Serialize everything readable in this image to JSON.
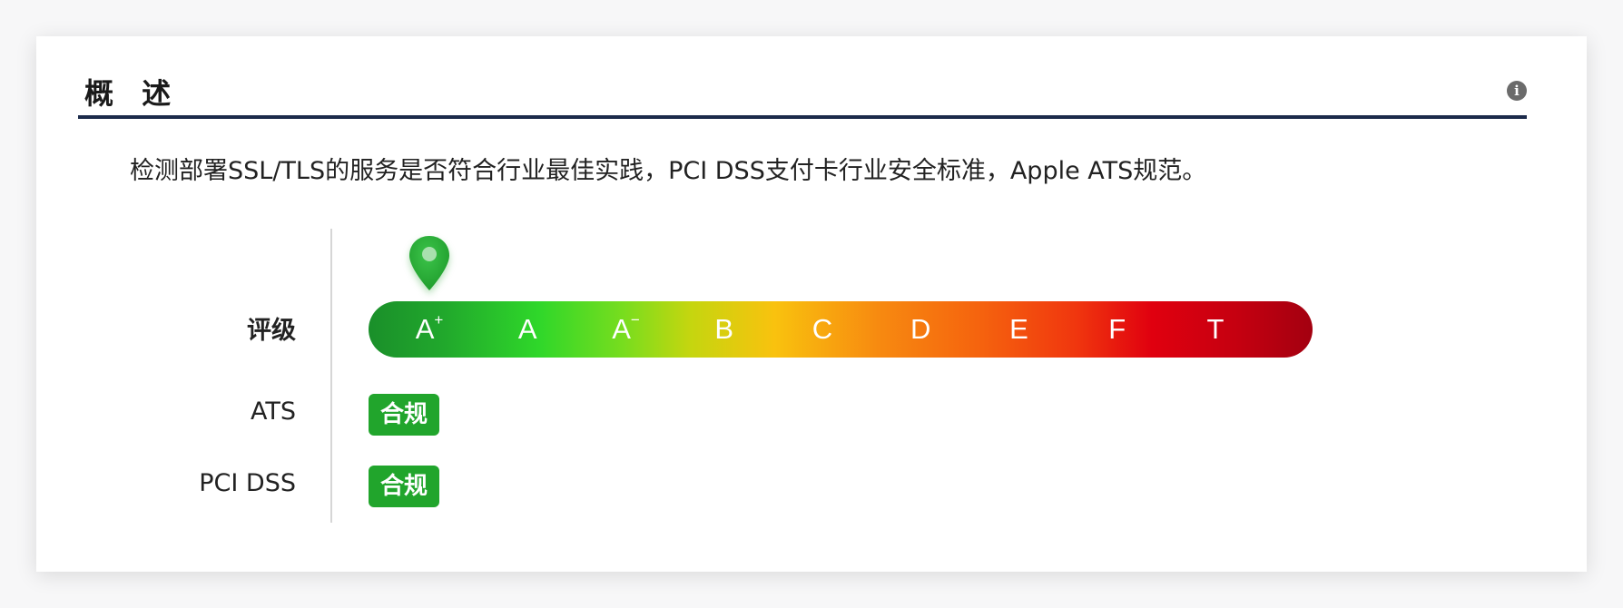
{
  "section": {
    "title": "概 述",
    "info_icon": "info-icon",
    "description": "检测部署SSL/TLS的服务是否符合行业最佳实践，PCI DSS支付卡行业安全标准，Apple ATS规范。"
  },
  "rows": {
    "grade_label": "评级",
    "ats_label": "ATS",
    "pci_label": "PCI DSS"
  },
  "grade_scale": {
    "grades": [
      {
        "base": "A",
        "mark": "+"
      },
      {
        "base": "A",
        "mark": ""
      },
      {
        "base": "A",
        "mark": "−"
      },
      {
        "base": "B",
        "mark": ""
      },
      {
        "base": "C",
        "mark": ""
      },
      {
        "base": "D",
        "mark": ""
      },
      {
        "base": "E",
        "mark": ""
      },
      {
        "base": "F",
        "mark": ""
      },
      {
        "base": "T",
        "mark": ""
      }
    ],
    "current_grade": "A+",
    "marker_icon": "map-pin-icon",
    "marker_color": "#21a52c"
  },
  "compliance": {
    "ats_status": "合规",
    "pci_status": "合规",
    "status_color": "#21a52c"
  }
}
